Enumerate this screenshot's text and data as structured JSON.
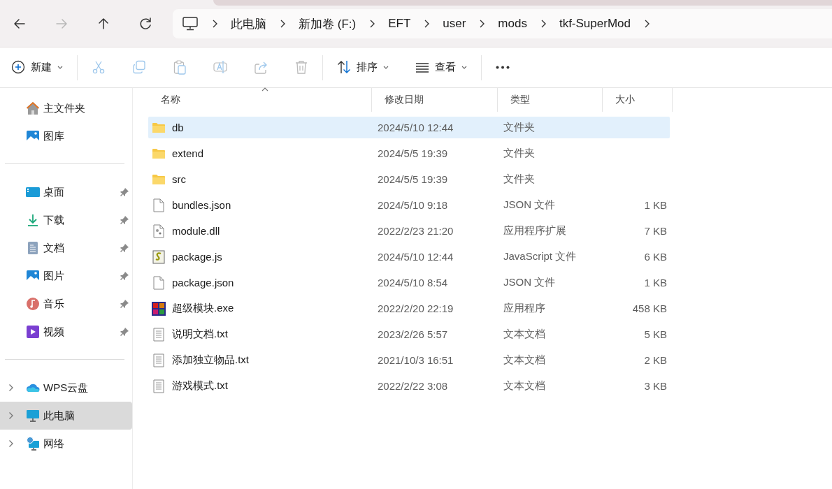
{
  "navigation": {
    "back": {
      "disabled": false
    },
    "forward": {
      "disabled": true
    },
    "up": {
      "disabled": false
    },
    "refresh": {
      "disabled": false
    }
  },
  "breadcrumb": [
    "此电脑",
    "新加卷 (F:)",
    "EFT",
    "user",
    "mods",
    "tkf-SuperMod"
  ],
  "toolbar": [
    {
      "kind": "new",
      "label": "新建",
      "disabled": false
    },
    {
      "kind": "cut",
      "disabled": true
    },
    {
      "kind": "copy",
      "disabled": true
    },
    {
      "kind": "paste",
      "disabled": true
    },
    {
      "kind": "rename",
      "disabled": true
    },
    {
      "kind": "share",
      "disabled": true
    },
    {
      "kind": "delete",
      "disabled": true
    },
    {
      "kind": "sort",
      "label": "排序",
      "disabled": false
    },
    {
      "kind": "view",
      "label": "查看",
      "disabled": false
    },
    {
      "kind": "more",
      "disabled": false
    }
  ],
  "sidebar": {
    "groups": [
      [
        {
          "kind": "home",
          "label": "主文件夹",
          "pinned": false,
          "selected": false
        },
        {
          "kind": "gallery",
          "label": "图库",
          "pinned": false,
          "selected": false
        }
      ],
      [
        {
          "kind": "desktop",
          "label": "桌面",
          "pinned": true,
          "selected": false
        },
        {
          "kind": "downloads",
          "label": "下载",
          "pinned": true,
          "selected": false
        },
        {
          "kind": "documents",
          "label": "文档",
          "pinned": true,
          "selected": false
        },
        {
          "kind": "pictures",
          "label": "图片",
          "pinned": true,
          "selected": false
        },
        {
          "kind": "music",
          "label": "音乐",
          "pinned": true,
          "selected": false
        },
        {
          "kind": "videos",
          "label": "视频",
          "pinned": true,
          "selected": false
        }
      ],
      [
        {
          "kind": "cloud",
          "label": "WPS云盘",
          "expanded": false,
          "selected": false
        },
        {
          "kind": "computer",
          "label": "此电脑",
          "expanded": false,
          "selected": true
        },
        {
          "kind": "network",
          "label": "网络",
          "expanded": false,
          "selected": false
        }
      ]
    ]
  },
  "table": {
    "columns": [
      {
        "label": "名称",
        "sorted": true
      },
      {
        "label": "修改日期",
        "sorted": false
      },
      {
        "label": "类型",
        "sorted": false
      },
      {
        "label": "大小",
        "sorted": false
      }
    ],
    "rows": [
      {
        "kind": "folder",
        "name": "db",
        "modified": "2024/5/10 12:44",
        "type": "文件夹",
        "size": "",
        "selected": true
      },
      {
        "kind": "folder",
        "name": "extend",
        "modified": "2024/5/5 19:39",
        "type": "文件夹",
        "size": "",
        "selected": false
      },
      {
        "kind": "folder",
        "name": "src",
        "modified": "2024/5/5 19:39",
        "type": "文件夹",
        "size": "",
        "selected": false
      },
      {
        "kind": "file",
        "name": "bundles.json",
        "modified": "2024/5/10 9:18",
        "type": "JSON 文件",
        "size": "1 KB",
        "selected": false
      },
      {
        "kind": "dll",
        "name": "module.dll",
        "modified": "2022/2/23 21:20",
        "type": "应用程序扩展",
        "size": "7 KB",
        "selected": false
      },
      {
        "kind": "script",
        "name": "package.js",
        "modified": "2024/5/10 12:44",
        "type": "JavaScript 文件",
        "size": "6 KB",
        "selected": false
      },
      {
        "kind": "file",
        "name": "package.json",
        "modified": "2024/5/10 8:54",
        "type": "JSON 文件",
        "size": "1 KB",
        "selected": false
      },
      {
        "kind": "exe",
        "name": "超级模块.exe",
        "modified": "2022/2/20 22:19",
        "type": "应用程序",
        "size": "458 KB",
        "selected": false
      },
      {
        "kind": "text",
        "name": "说明文档.txt",
        "modified": "2023/2/26 5:57",
        "type": "文本文档",
        "size": "5 KB",
        "selected": false
      },
      {
        "kind": "text",
        "name": "添加独立物品.txt",
        "modified": "2021/10/3 16:51",
        "type": "文本文档",
        "size": "2 KB",
        "selected": false
      },
      {
        "kind": "text",
        "name": "游戏模式.txt",
        "modified": "2022/2/22 3:08",
        "type": "文本文档",
        "size": "3 KB",
        "selected": false
      }
    ]
  }
}
